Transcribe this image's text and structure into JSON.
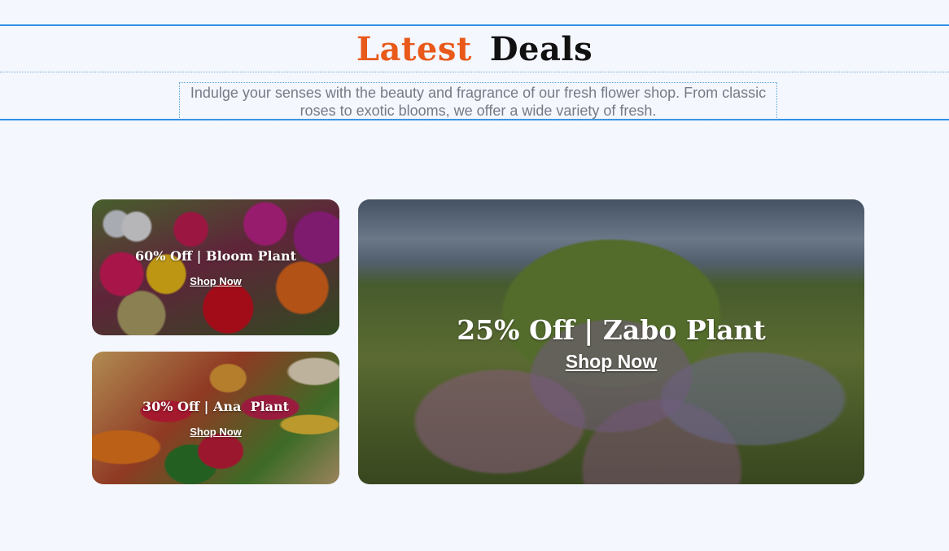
{
  "section": {
    "title_accent": "Latest",
    "title_rest": "Deals",
    "subtitle": "Indulge your senses with the beauty and fragrance of our fresh flower shop. From classic roses to exotic blooms, we offer a wide variety of fresh."
  },
  "colors": {
    "accent": "#e8591a",
    "divider": "#2f8fe6",
    "background": "#f4f7fe"
  },
  "deals": [
    {
      "headline": "60% Off | Bloom Plant",
      "link": "Shop Now"
    },
    {
      "headline": "30% Off | Ana  Plant",
      "link": "Shop Now"
    },
    {
      "headline": "25% Off | Zabo Plant",
      "link": "Shop Now"
    }
  ]
}
